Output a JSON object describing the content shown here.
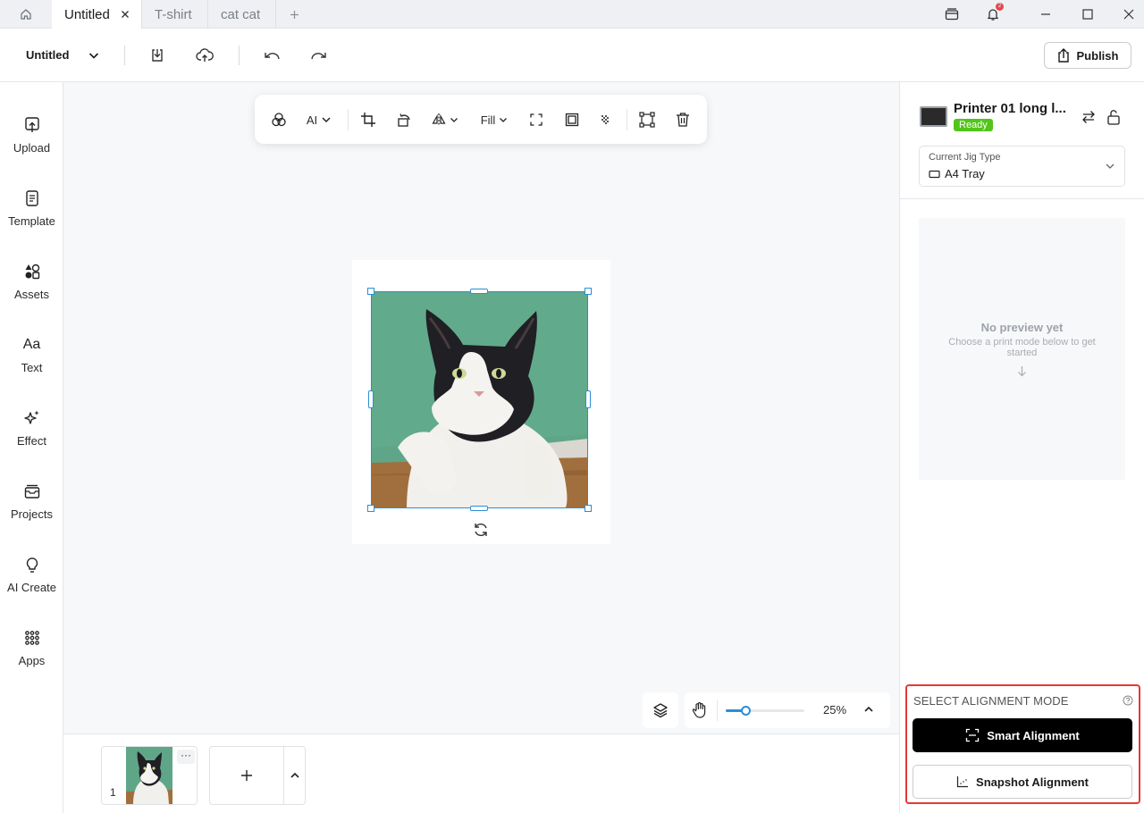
{
  "tabs": {
    "home_icon": "home-icon",
    "items": [
      {
        "label": "Untitled",
        "active": true
      },
      {
        "label": "T-shirt",
        "active": false
      },
      {
        "label": "cat cat",
        "active": false
      }
    ],
    "add_icon": "plus-icon"
  },
  "window": {
    "notification_count": "2",
    "icons": [
      "tray-icon",
      "bell-icon",
      "minimize-icon",
      "maximize-icon",
      "close-icon"
    ]
  },
  "toolbar": {
    "doc_title": "Untitled",
    "publish_label": "Publish",
    "icons": [
      "chevron-down-icon",
      "download-icon",
      "cloud-upload-icon",
      "undo-icon",
      "redo-icon",
      "share-icon"
    ]
  },
  "sidebar": {
    "items": [
      {
        "label": "Upload",
        "icon": "upload-icon"
      },
      {
        "label": "Template",
        "icon": "template-icon"
      },
      {
        "label": "Assets",
        "icon": "assets-icon"
      },
      {
        "label": "Text",
        "icon": "text-icon"
      },
      {
        "label": "Effect",
        "icon": "sparkle-icon"
      },
      {
        "label": "Projects",
        "icon": "projects-icon"
      },
      {
        "label": "AI Create",
        "icon": "lightbulb-icon"
      },
      {
        "label": "Apps",
        "icon": "apps-grid-icon"
      }
    ]
  },
  "image_tools": {
    "ai_label": "AI",
    "fill_label": "Fill",
    "icons": [
      "color-filter-icon",
      "crop-icon",
      "rotate-icon",
      "flip-icon",
      "fullscreen-icon",
      "frame-icon",
      "transparency-icon",
      "transform-icon",
      "trash-icon"
    ]
  },
  "canvas": {
    "image_subject": "cat photo",
    "zoom_label": "25%",
    "zoom_fraction": 0.25
  },
  "pages": {
    "items": [
      {
        "number": "1"
      }
    ],
    "more_label": "···",
    "add_icon": "plus-icon"
  },
  "printer": {
    "name": "Printer 01 long l...",
    "status": "Ready",
    "jig_label": "Current Jig Type",
    "jig_value": "A4 Tray"
  },
  "preview": {
    "title": "No preview yet",
    "hint": "Choose a print mode below to get started"
  },
  "alignment": {
    "title": "SELECT ALIGNMENT MODE",
    "smart_label": "Smart Alignment",
    "snapshot_label": "Snapshot Alignment"
  },
  "colors": {
    "accent": "#2b8ed6",
    "ready": "#52c41a",
    "highlight": "#e53935",
    "notification": "#e5484d"
  }
}
